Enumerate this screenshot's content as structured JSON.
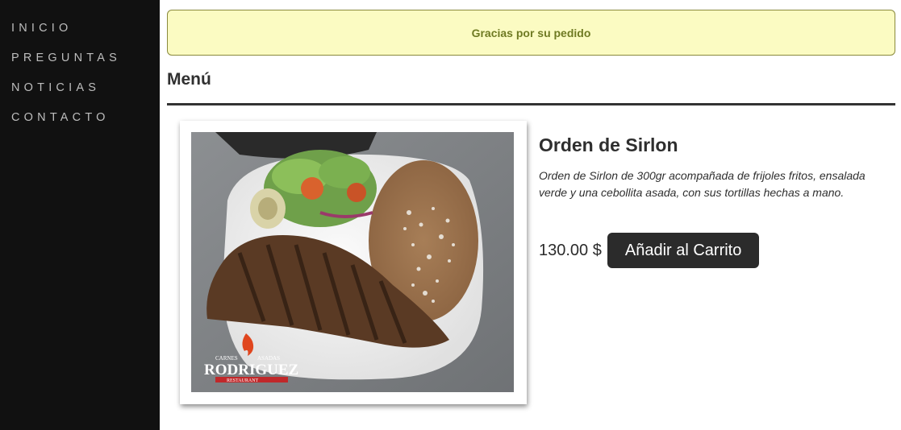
{
  "sidebar": {
    "items": [
      {
        "label": "INICIO"
      },
      {
        "label": "PREGUNTAS"
      },
      {
        "label": "NOTICIAS"
      },
      {
        "label": "CONTACTO"
      }
    ]
  },
  "alert": {
    "message": "Gracias por su pedido"
  },
  "menu": {
    "title": "Menú"
  },
  "product": {
    "name": "Orden de Sirlon",
    "description": "Orden de Sirlon de 300gr acompañada de frijoles fritos, ensalada verde y una cebollita asada, con sus tortillas hechas a mano.",
    "price": "130.00 $",
    "add_to_cart_label": "Añadir al Carrito",
    "image": {
      "subject": "steak-plate-photo",
      "watermark": {
        "top_left": "CARNES",
        "top_right": "ASADAS",
        "brand": "RODRIGUEZ",
        "bottom": "RESTAURANT"
      }
    }
  },
  "colors": {
    "sidebar_bg": "#111111",
    "sidebar_text": "#bdbdbd",
    "alert_bg": "#fbfbc2",
    "alert_border": "#8a8a3c",
    "alert_text": "#6f7a23",
    "button_bg": "#2b2b2b"
  }
}
